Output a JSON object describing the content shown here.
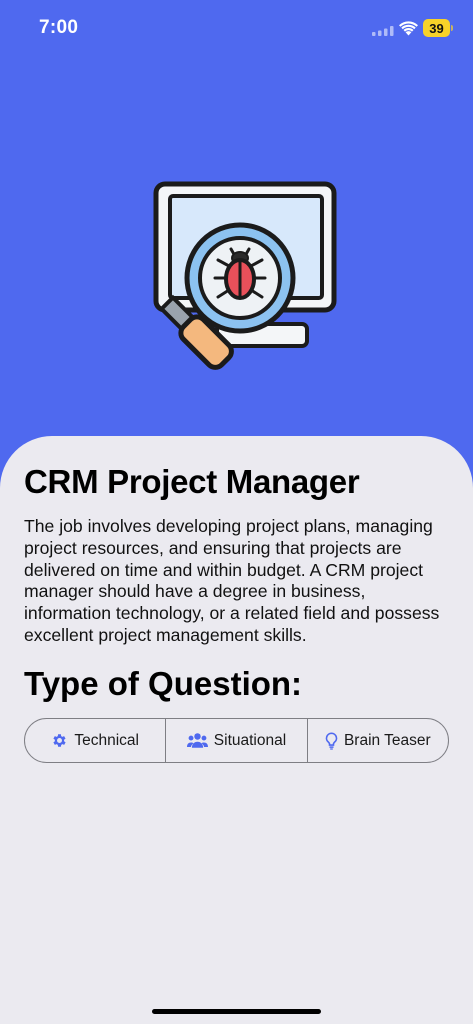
{
  "status_bar": {
    "time": "7:00",
    "battery_level": "39",
    "battery_color": "#f7d229"
  },
  "hero": {
    "icon": "bug-search-monitor-icon",
    "background_color": "#4f69ef"
  },
  "job": {
    "title": "CRM Project Manager",
    "description": "The job involves developing project plans, managing project resources, and ensuring that projects are delivered on time and within budget. A CRM project manager should have a degree in business, information technology, or a related field and possess excellent project management skills."
  },
  "question_types": {
    "heading": "Type of Question:",
    "accent_color": "#4f69ef",
    "options": [
      {
        "label": "Technical",
        "icon": "gear-icon"
      },
      {
        "label": "Situational",
        "icon": "people-icon"
      },
      {
        "label": "Brain Teaser",
        "icon": "lightbulb-icon"
      }
    ]
  }
}
